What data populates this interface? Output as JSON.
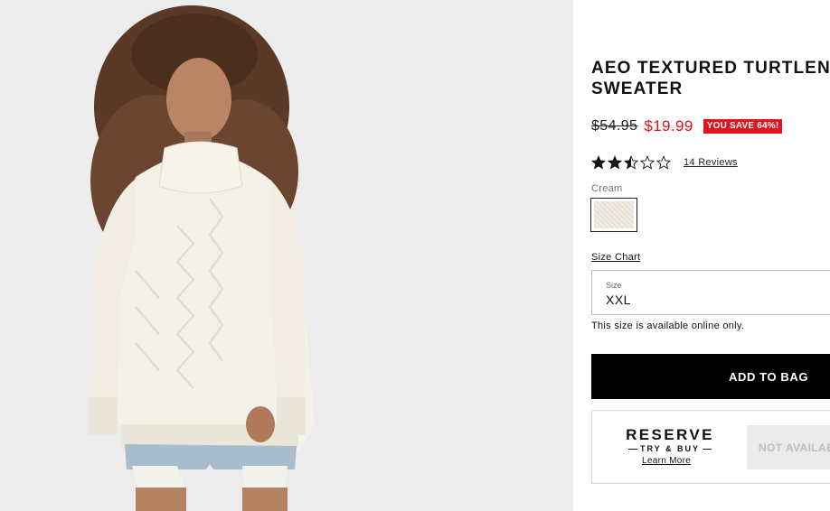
{
  "product": {
    "title_line1": "AEO TEXTURED TURTLENECK",
    "title_line2": "SWEATER",
    "old_price": "$54.95",
    "sale_price": "$19.99",
    "save_badge": "YOU SAVE 64%!",
    "rating": 2.5,
    "rating_max": 5,
    "reviews_link": "14 Reviews"
  },
  "color": {
    "label": "Cream",
    "swatch_color": "#ece7dc"
  },
  "size": {
    "chart_link": "Size Chart",
    "field_label": "Size",
    "selected": "XXL",
    "availability_note": "This size is available online only."
  },
  "actions": {
    "add_to_bag": "ADD TO BAG",
    "reserve_logo": "RESERVE",
    "reserve_sub": "TRY & BUY",
    "learn_more": "Learn More",
    "not_available": "NOT AVAILABLE"
  },
  "colors": {
    "sale_red": "#dd1111",
    "badge_red": "#e0141e",
    "button_black": "#000000"
  }
}
